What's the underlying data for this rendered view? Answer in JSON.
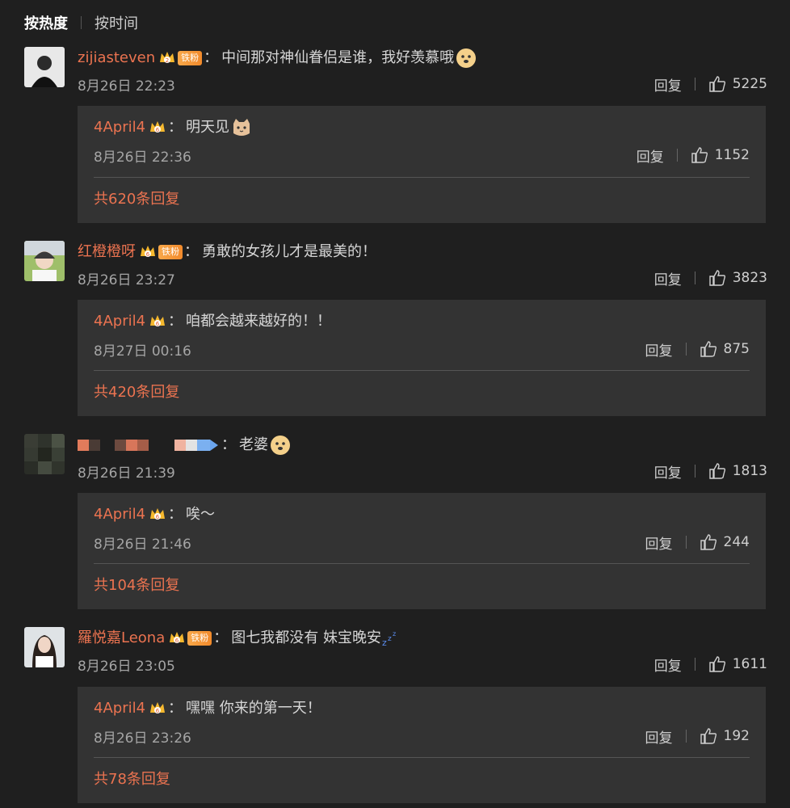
{
  "sort": {
    "hot": "按热度",
    "time": "按时间"
  },
  "fan_badge": "铁粉",
  "colon": "：",
  "reply_label": "回复",
  "comments": [
    {
      "user": "zijiasteven",
      "text": "中间那对神仙眷侣是谁，我好羡慕哦",
      "time": "8月26日 22:23",
      "likes": "5225",
      "reply": {
        "user": "4April4",
        "text": "明天见",
        "time": "8月26日 22:36",
        "likes": "1152"
      },
      "more": "共620条回复"
    },
    {
      "user": "红橙橙呀",
      "text": "勇敢的女孩儿才是最美的！",
      "time": "8月26日 23:27",
      "likes": "3823",
      "reply": {
        "user": "4April4",
        "text": "咱都会越来越好的！！",
        "time": "8月27日 00:16",
        "likes": "875"
      },
      "more": "共420条回复"
    },
    {
      "user": "",
      "text": "老婆",
      "time": "8月26日 21:39",
      "likes": "1813",
      "reply": {
        "user": "4April4",
        "text": "唉～",
        "time": "8月26日 21:46",
        "likes": "244"
      },
      "more": "共104条回复"
    },
    {
      "user": "羅悦嘉Leona",
      "text": "图七我都没有 妹宝晚安",
      "time": "8月26日 23:05",
      "likes": "1611",
      "reply": {
        "user": "4April4",
        "text": "嘿嘿 你来的第一天！",
        "time": "8月26日 23:26",
        "likes": "192"
      },
      "more": "共78条回复"
    }
  ],
  "colors": {
    "username": "#eb7350",
    "background": "#1f1f1f",
    "reply_bg": "#333333"
  }
}
